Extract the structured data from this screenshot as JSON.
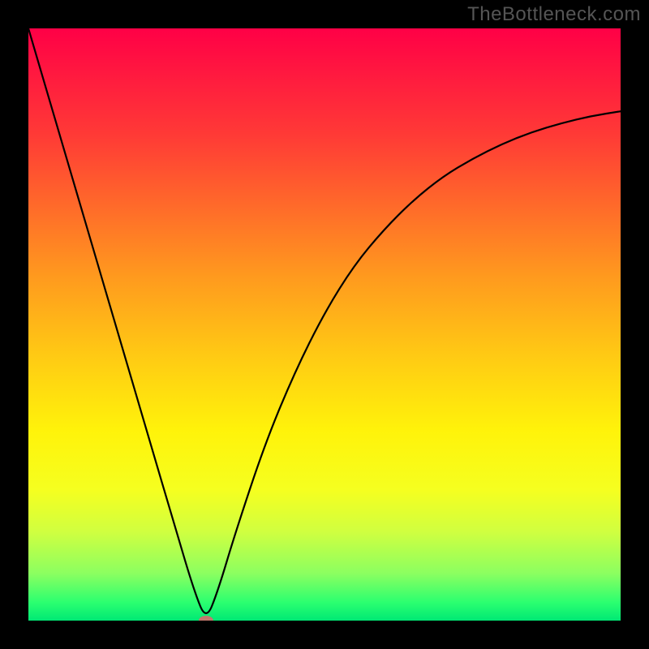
{
  "watermark": "TheBottleneck.com",
  "colors": {
    "background": "#000000",
    "curve": "#000000",
    "marker": "#d66b6b",
    "gradient_top": "#ff0046",
    "gradient_bottom": "#00e874"
  },
  "chart_data": {
    "type": "line",
    "title": "",
    "xlabel": "",
    "ylabel": "",
    "xlim": [
      0,
      100
    ],
    "ylim": [
      0,
      100
    ],
    "grid": false,
    "legend": false,
    "series": [
      {
        "name": "bottleneck-curve",
        "x": [
          0,
          5,
          10,
          15,
          20,
          25,
          28,
          30,
          32,
          35,
          40,
          45,
          50,
          55,
          60,
          65,
          70,
          75,
          80,
          85,
          90,
          95,
          100
        ],
        "y": [
          100,
          83,
          66,
          49,
          32,
          15,
          5,
          0,
          5,
          15,
          30,
          42,
          52,
          60,
          66,
          71,
          75,
          78,
          80.5,
          82.5,
          84,
          85.2,
          86
        ]
      }
    ],
    "marker": {
      "x": 30,
      "y": 0
    },
    "background_gradient_stops": [
      {
        "pos": 0.0,
        "color": "#ff0046"
      },
      {
        "pos": 0.3,
        "color": "#ff6a2a"
      },
      {
        "pos": 0.55,
        "color": "#ffc914"
      },
      {
        "pos": 0.78,
        "color": "#f5ff20"
      },
      {
        "pos": 0.92,
        "color": "#8cff60"
      },
      {
        "pos": 1.0,
        "color": "#00e874"
      }
    ]
  }
}
